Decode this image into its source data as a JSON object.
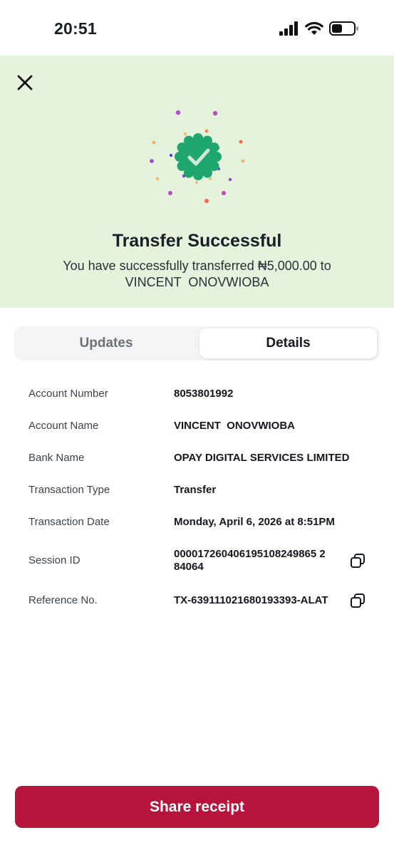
{
  "status_bar": {
    "time": "20:51"
  },
  "hero": {
    "title": "Transfer Successful",
    "message_line1": "You have successfully transferred ₦5,000.00 to",
    "message_line2": "VINCENT  ONOVWIOBA",
    "background_color": "#e5f2dc",
    "badge_color": "#1fa66e"
  },
  "tabs": [
    {
      "label": "Updates",
      "active": false
    },
    {
      "label": "Details",
      "active": true
    }
  ],
  "details": [
    {
      "label": "Account Number",
      "value": "8053801992",
      "copyable": false
    },
    {
      "label": "Account Name",
      "value": "VINCENT  ONOVWIOBA",
      "copyable": false
    },
    {
      "label": "Bank Name",
      "value": "OPAY DIGITAL SERVICES LIMITED",
      "copyable": false
    },
    {
      "label": "Transaction Type",
      "value": "Transfer",
      "copyable": false
    },
    {
      "label": "Transaction Date",
      "value": "Monday, April 6, 2026 at 8:51PM",
      "copyable": false
    },
    {
      "label": "Session ID",
      "value_line1": "000017260406195108249865 2",
      "value_line2": "84064",
      "copyable": true
    },
    {
      "label": "Reference No.",
      "value": "TX-639111021680193393-ALAT",
      "copyable": true
    }
  ],
  "share_button": {
    "label": "Share receipt",
    "color": "#b7143b"
  },
  "icons": [
    "signal-icon",
    "wifi-icon",
    "battery-icon",
    "close-icon",
    "success-badge-icon",
    "copy-icon"
  ]
}
